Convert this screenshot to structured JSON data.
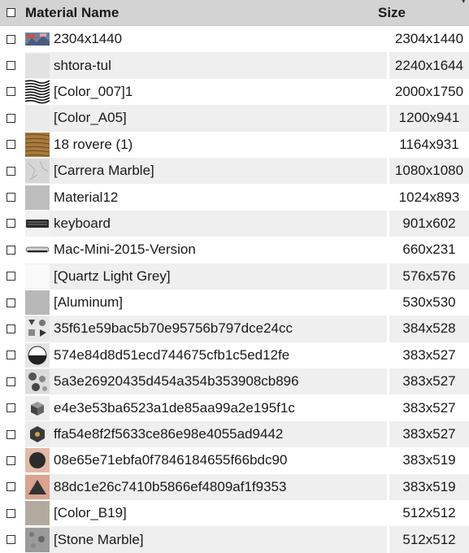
{
  "header": {
    "name_label": "Material Name",
    "size_label": "Size",
    "sort_icon": "▾"
  },
  "rows": [
    {
      "name": "2304x1440",
      "size": "2304x1440",
      "thumb": "landscape-thumbnail"
    },
    {
      "name": "shtora-tul",
      "size": "2240x1644",
      "thumb": "light-gray-thumbnail"
    },
    {
      "name": "[Color_007]1",
      "size": "2000x1750",
      "thumb": "zebra-pattern-thumbnail"
    },
    {
      "name": "[Color_A05]",
      "size": "1200x941",
      "thumb": "very-light-gray-thumbnail"
    },
    {
      "name": "18 rovere (1)",
      "size": "1164x931",
      "thumb": "wood-thumbnail"
    },
    {
      "name": "[Carrera Marble]",
      "size": "1080x1080",
      "thumb": "marble-thumbnail"
    },
    {
      "name": "Material12",
      "size": "1024x893",
      "thumb": "gray-thumbnail"
    },
    {
      "name": "keyboard",
      "size": "901x602",
      "thumb": "keyboard-thumbnail"
    },
    {
      "name": "Mac-Mini-2015-Version",
      "size": "660x231",
      "thumb": "mac-mini-thumbnail"
    },
    {
      "name": "[Quartz Light Grey]",
      "size": "576x576",
      "thumb": "white-thumbnail"
    },
    {
      "name": "[Aluminum]",
      "size": "530x530",
      "thumb": "aluminum-thumbnail"
    },
    {
      "name": "35f61e59bac5b70e95756b797dce24cc",
      "size": "384x528",
      "thumb": "geometric-pattern-thumbnail"
    },
    {
      "name": "574e84d8d51ecd744675cfb1c5ed12fe",
      "size": "383x527",
      "thumb": "half-circle-thumbnail"
    },
    {
      "name": "5a3e26920435d454a354b353908cb896",
      "size": "383x527",
      "thumb": "floral-pattern-thumbnail"
    },
    {
      "name": "e4e3e53ba6523a1de85aa99a2e195f1c",
      "size": "383x527",
      "thumb": "cube-thumbnail"
    },
    {
      "name": "ffa54e8f2f5633ce86e98e4055ad9442",
      "size": "383x527",
      "thumb": "hexagon-thumbnail"
    },
    {
      "name": "08e65e71ebfa0f7846184655f66bdc90",
      "size": "383x519",
      "thumb": "dark-circle-thumbnail"
    },
    {
      "name": "88dc1e26c7410b5866ef4809af1f9353",
      "size": "383x519",
      "thumb": "triangle-thumbnail"
    },
    {
      "name": "[Color_B19]",
      "size": "512x512",
      "thumb": "beige-thumbnail"
    },
    {
      "name": "[Stone Marble]",
      "size": "512x512",
      "thumb": "stone-thumbnail"
    }
  ]
}
